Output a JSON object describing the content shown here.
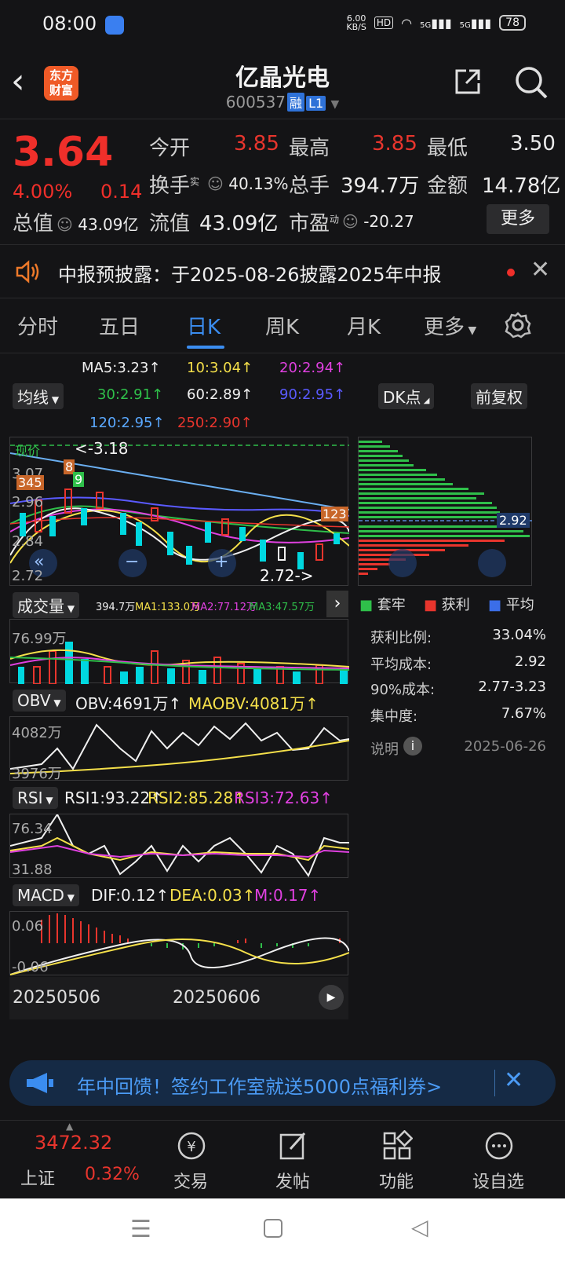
{
  "status": {
    "time": "08:00",
    "speed_value": "6.00",
    "speed_unit": "KB/S",
    "hd": "HD",
    "net1": "5G",
    "net2": "5G",
    "battery": "78"
  },
  "header": {
    "logo_line1": "东方",
    "logo_line2": "财富",
    "name": "亿晶光电",
    "code": "600537",
    "tag_margin": "融",
    "tag_level": "L1"
  },
  "quote": {
    "price": "3.64",
    "pct": "4.00%",
    "change": "0.14",
    "open_label": "今开",
    "open": "3.85",
    "high_label": "最高",
    "high": "3.85",
    "low_label": "最低",
    "low": "3.50",
    "turnover_label": "换手",
    "turnover_sup": "实",
    "turnover": "40.13%",
    "volume_label": "总手",
    "volume": "394.7万",
    "amount_label": "金额",
    "amount": "14.78亿",
    "mcap_label": "总值",
    "mcap": "43.09亿",
    "float_label": "流值",
    "float": "43.09亿",
    "pe_label": "市盈",
    "pe_sup": "动",
    "pe": "-20.27",
    "more": "更多"
  },
  "notice": {
    "text": "中报预披露：于2025-08-26披露2025年中报"
  },
  "tabs": [
    "分时",
    "五日",
    "日K",
    "周K",
    "月K",
    "更多"
  ],
  "ma": {
    "ma5": "MA5:3.23",
    "ma10": "10:3.04",
    "ma20": "20:2.94",
    "ma30": "30:2.91",
    "ma60": "60:2.89",
    "ma90": "90:2.95",
    "ma120": "120:2.95",
    "ma250": "250:2.90",
    "selector": "均线",
    "dk": "DK点",
    "adj": "前复权"
  },
  "kline": {
    "high_label": "3.18",
    "top_tick": "3.07",
    "tick2": "2.96",
    "tick3": "2.84",
    "bottom_tick": "2.72",
    "low_label": "2.72->",
    "marker_345": "345",
    "marker_8": "8",
    "marker_9": "9",
    "marker_123": "123",
    "overlay_text": "现价",
    "cost_value": "2.92"
  },
  "chips": {
    "legend_trapped": "套牢",
    "legend_profit": "获利",
    "legend_avg": "平均",
    "profit_ratio_label": "获利比例:",
    "profit_ratio": "33.04%",
    "avg_cost_label": "平均成本:",
    "avg_cost": "2.92",
    "cost90_label": "90%成本:",
    "cost90": "2.77-3.23",
    "concentration_label": "集中度:",
    "concentration": "7.67%",
    "note_label": "说明",
    "date": "2025-06-26"
  },
  "volume": {
    "label": "成交量",
    "vol": "394.7万",
    "ma1": "MA1:133.0万",
    "ma2": "MA2:77.12万",
    "ma3": "MA3:47.57万",
    "top": "76.99万"
  },
  "obv": {
    "label": "OBV",
    "obv": "OBV:4691万",
    "maobv": "MAOBV:4081万",
    "top": "4082万",
    "bottom": "3976万"
  },
  "rsi": {
    "label": "RSI",
    "rsi1": "RSI1:93.22",
    "rsi2": "RSI2:85.28",
    "rsi3": "RSI3:72.63",
    "top": "76.34",
    "bottom": "31.88"
  },
  "macd": {
    "label": "MACD",
    "dif": "DIF:0.12",
    "dea": "DEA:0.03",
    "m": "M:0.17",
    "top": "0.06",
    "bottom": "-0.06"
  },
  "dates": {
    "d1": "20250506",
    "d2": "20250606"
  },
  "promo": {
    "text": "年中回馈！签约工作室就送5000点福利券>"
  },
  "bottom": {
    "index_value": "3472.32",
    "index_name": "上证",
    "index_pct": "0.32%",
    "trade": "交易",
    "post": "发帖",
    "func": "功能",
    "watch": "设自选"
  },
  "colors": {
    "up": "#e8352d",
    "down": "#00d8e0",
    "accent": "#3b8df0",
    "yellow": "#f5e04a",
    "magenta": "#e040e0"
  }
}
